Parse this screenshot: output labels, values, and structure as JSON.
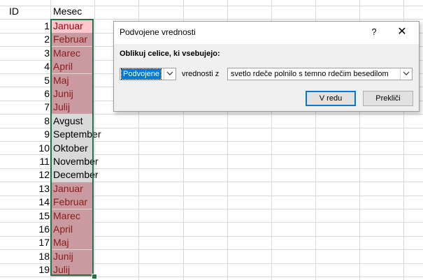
{
  "sheet": {
    "headers": {
      "col_a": "ID",
      "col_b": "Mesec"
    },
    "rows": [
      {
        "id": "1",
        "month": "Januar",
        "format": "first"
      },
      {
        "id": "2",
        "month": "Februar",
        "format": "dup"
      },
      {
        "id": "3",
        "month": "Marec",
        "format": "dup"
      },
      {
        "id": "4",
        "month": "April",
        "format": "dup"
      },
      {
        "id": "5",
        "month": "Maj",
        "format": "dup"
      },
      {
        "id": "6",
        "month": "Junij",
        "format": "dup"
      },
      {
        "id": "7",
        "month": "Julij",
        "format": "dup"
      },
      {
        "id": "8",
        "month": "Avgust",
        "format": "plain"
      },
      {
        "id": "9",
        "month": "September",
        "format": "plain"
      },
      {
        "id": "10",
        "month": "Oktober",
        "format": "plain"
      },
      {
        "id": "11",
        "month": "November",
        "format": "plain"
      },
      {
        "id": "12",
        "month": "December",
        "format": "plain"
      },
      {
        "id": "13",
        "month": "Januar",
        "format": "dup"
      },
      {
        "id": "14",
        "month": "Februar",
        "format": "dup"
      },
      {
        "id": "15",
        "month": "Marec",
        "format": "dup"
      },
      {
        "id": "16",
        "month": "April",
        "format": "dup"
      },
      {
        "id": "17",
        "month": "Maj",
        "format": "dup"
      },
      {
        "id": "18",
        "month": "Junij",
        "format": "dup"
      },
      {
        "id": "19",
        "month": "Julij",
        "format": "dup"
      }
    ]
  },
  "dialog": {
    "title": "Podvojene vrednosti",
    "help_glyph": "?",
    "close_glyph": "✕",
    "instruction": "Oblikuj celice, ki vsebujejo:",
    "type_select": {
      "value": "Podvojene"
    },
    "values_with_label": "vrednosti z",
    "format_select": {
      "value": "svetlo rdeče polnilo s temno rdečim besedilom"
    },
    "ok_label": "V redu",
    "cancel_label": "Prekliči"
  },
  "colors": {
    "duplicate_fill": "#c99ba1",
    "duplicate_text": "#8b1a1a",
    "selection_border": "#217346",
    "accent": "#0078d7"
  }
}
